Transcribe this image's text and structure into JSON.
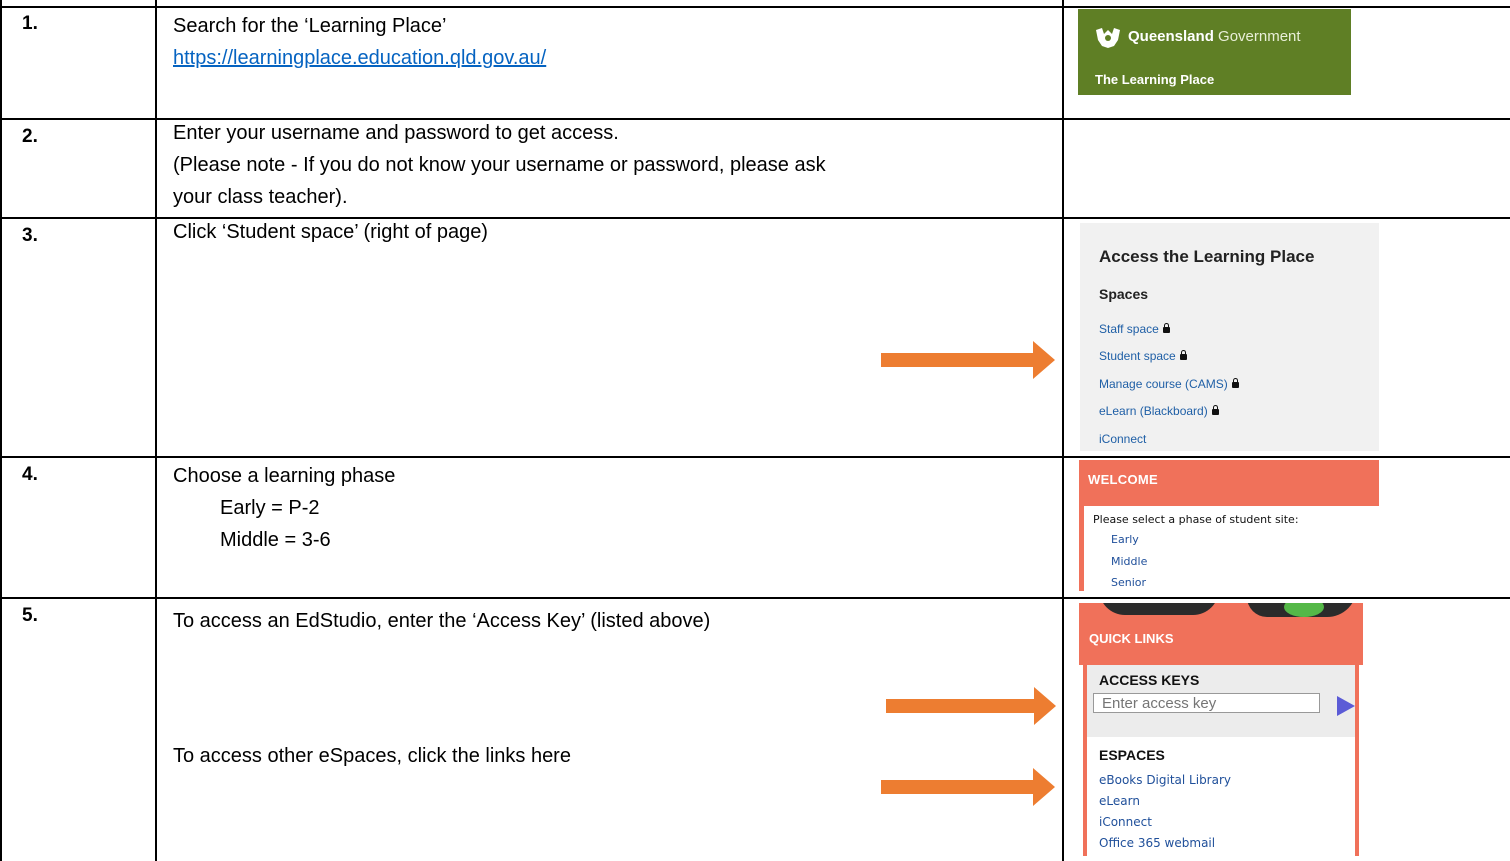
{
  "steps": [
    {
      "number": "1.",
      "lines": [
        "Search for the ‘Learning Place’"
      ],
      "link": "https://learningplace.education.qld.gov.au/"
    },
    {
      "number": "2.",
      "lines": [
        "Enter your username and password to get access.",
        "(Please note - If you do not know your username or password, please ask",
        "your class teacher)."
      ]
    },
    {
      "number": "3.",
      "lines": [
        "Click ‘Student space’ (right of page)"
      ]
    },
    {
      "number": "4.",
      "lines": [
        "Choose a learning phase",
        "Early = P-2",
        "Middle = 3-6"
      ]
    },
    {
      "number": "5.",
      "lines": [
        "To access an EdStudio, enter the ‘Access Key’ (listed above)"
      ],
      "lines_b": [
        "To access other eSpaces, click the links here"
      ]
    }
  ],
  "qld_banner": {
    "brand_bold": "Queensland",
    "brand_rest": " Government",
    "subtitle": "The Learning Place"
  },
  "access_panel": {
    "title": "Access the Learning Place",
    "section": "Spaces",
    "items": [
      {
        "label": "Staff space",
        "locked": true
      },
      {
        "label": "Student space",
        "locked": true
      },
      {
        "label": "Manage course (CAMS)",
        "locked": true
      },
      {
        "label": "eLearn (Blackboard)",
        "locked": true
      },
      {
        "label": "iConnect",
        "locked": false
      }
    ]
  },
  "welcome_panel": {
    "heading": "WELCOME",
    "prompt": "Please select a phase of student site:",
    "phases": [
      "Early",
      "Middle",
      "Senior"
    ]
  },
  "quick_links_panel": {
    "heading": "QUICK LINKS",
    "access_keys_title": "ACCESS KEYS",
    "access_key_placeholder": "Enter access key",
    "espaces_title": "ESPACES",
    "espaces": [
      "eBooks Digital Library",
      "eLearn",
      "iConnect",
      "Office 365 webmail"
    ]
  },
  "colors": {
    "arrow": "#ed7d31",
    "qld_green": "#5f7f25",
    "coral": "#f0715a",
    "link": "#0563c1"
  }
}
